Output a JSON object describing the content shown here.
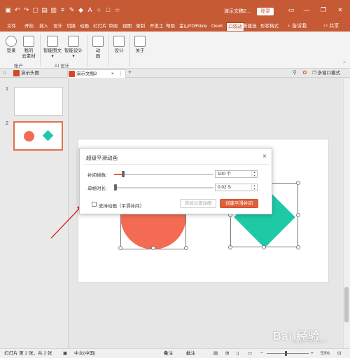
{
  "titlebar": {
    "doc_title": "演示文稿2...",
    "login": "登录",
    "minimize": "—",
    "restore": "❐",
    "close": "✕"
  },
  "ribbon_tabs": [
    "文件",
    "开始",
    "插入",
    "设计",
    "切换",
    "动画",
    "幻灯片",
    "审阅",
    "视图",
    "录制",
    "开发工",
    "帮助",
    "金山PDF",
    "iSlide",
    "OneK",
    "口袋动",
    "新建选",
    "形状格式"
  ],
  "ribbon_active_tab": "口袋动",
  "tellme": "告诉我",
  "share": "共享",
  "ribbon": {
    "login": "登录",
    "cloud_line1": "我的",
    "cloud_line2": "云素材",
    "account_group": "账户",
    "smart_graphic_line1": "智能图文",
    "smart_graphic_line2": "",
    "smart_design_line1": "智能设计",
    "ai_group": "AI 设计",
    "animation": "动",
    "animation2": "画",
    "design": "设计",
    "about": "关于"
  },
  "doc_tabs": {
    "tab1": "演示头图",
    "tab2": "演示文稿2",
    "tab2_close": "×",
    "add": "+",
    "multiwindow": "多窗口模式"
  },
  "slides": [
    {
      "number": "1"
    },
    {
      "number": "2"
    }
  ],
  "colors": {
    "accent": "#c55a34",
    "circle": "#f26b52",
    "diamond": "#1ec9a6",
    "primary_button": "#e0603a"
  },
  "dialog": {
    "title": "超级平滑动画",
    "close": "×",
    "frames_label": "补间帧数:",
    "frames_value": "100 个",
    "frames_fraction": 0.08,
    "duration_label": "单帧时长:",
    "duration_value": "0.02 S",
    "duration_fraction": 0.0,
    "checkbox_label": "支持动画（平滑补间）",
    "checkbox_checked": false,
    "add_transition_button": "添加过渡动画",
    "create_button": "创建平滑补间"
  },
  "statusbar": {
    "slide_info": "幻灯片 第 2 张，共 2 张",
    "language": "中文(中国)",
    "notes": "备注",
    "comments": "批注",
    "zoom": "53%"
  },
  "watermark": {
    "text": "Bai 经验",
    "sub": "jingyan.baidu.com"
  }
}
